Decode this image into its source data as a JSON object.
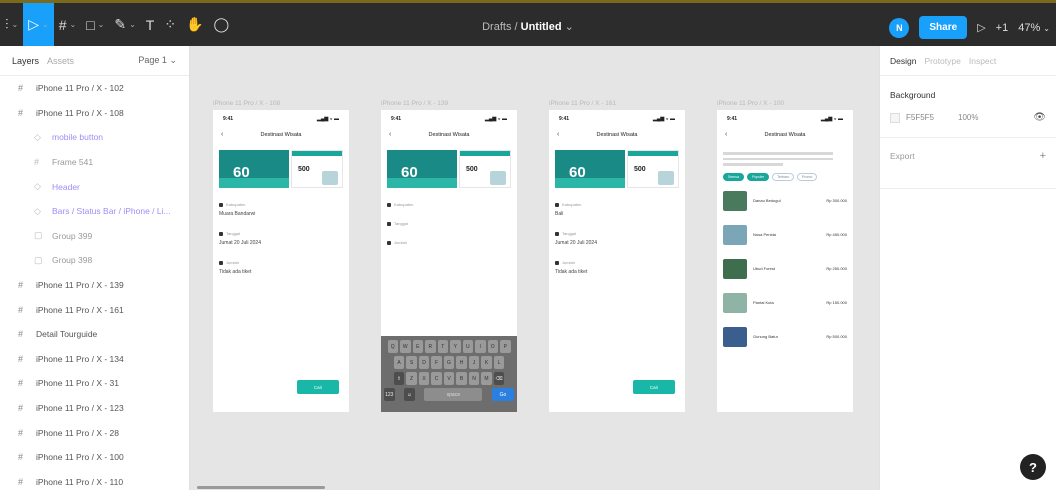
{
  "toolbar": {
    "tools": [
      {
        "name": "main-menu-icon",
        "glyph": "⫶",
        "caret": "⌄"
      },
      {
        "name": "move-tool-icon",
        "glyph": "▷",
        "caret": "⌄",
        "active": true
      },
      {
        "name": "frame-tool-icon",
        "glyph": "#",
        "caret": "⌄"
      },
      {
        "name": "shape-tool-icon",
        "glyph": "□",
        "caret": "⌄"
      },
      {
        "name": "pen-tool-icon",
        "glyph": "✎",
        "caret": "⌄"
      },
      {
        "name": "text-tool-icon",
        "glyph": "T",
        "caret": ""
      },
      {
        "name": "resources-icon",
        "glyph": "⁘",
        "caret": ""
      },
      {
        "name": "hand-tool-icon",
        "glyph": "✋",
        "caret": ""
      },
      {
        "name": "comment-tool-icon",
        "glyph": "◯",
        "caret": ""
      }
    ],
    "breadcrumb_folder": "Drafts",
    "separator": "/",
    "file_name": "Untitled",
    "file_caret": "⌄",
    "avatar_initial": "N",
    "share_label": "Share",
    "present_glyph": "▷",
    "library_label": "+1",
    "zoom": "47%",
    "zoom_caret": "⌄",
    "accent": "#18a0fb"
  },
  "left_panel": {
    "tab_layers": "Layers",
    "tab_assets": "Assets",
    "page": "Page 1",
    "page_caret": "⌄",
    "layers": [
      {
        "label": "iPhone 11 Pro / X - 102",
        "icon": "#",
        "type": "frame"
      },
      {
        "label": "iPhone 11 Pro / X - 108",
        "icon": "#",
        "type": "frame"
      },
      {
        "label": "mobile button",
        "icon": "◇",
        "type": "child comp"
      },
      {
        "label": "Frame 541",
        "icon": "#",
        "type": "child"
      },
      {
        "label": "Header",
        "icon": "◇",
        "type": "child comp"
      },
      {
        "label": "Bars / Status Bar / iPhone / Li...",
        "icon": "◇",
        "type": "child comp"
      },
      {
        "label": "Group 399",
        "icon": "▢",
        "type": "child"
      },
      {
        "label": "Group 398",
        "icon": "▢",
        "type": "child"
      },
      {
        "label": "iPhone 11 Pro / X - 139",
        "icon": "#",
        "type": "frame"
      },
      {
        "label": "iPhone 11 Pro / X - 161",
        "icon": "#",
        "type": "frame"
      },
      {
        "label": "Detail Tourguide",
        "icon": "#",
        "type": "frame"
      },
      {
        "label": "iPhone 11 Pro / X - 134",
        "icon": "#",
        "type": "frame"
      },
      {
        "label": "iPhone 11 Pro / X - 31",
        "icon": "#",
        "type": "frame"
      },
      {
        "label": "iPhone 11 Pro / X - 123",
        "icon": "#",
        "type": "frame"
      },
      {
        "label": "iPhone 11 Pro / X - 28",
        "icon": "#",
        "type": "frame"
      },
      {
        "label": "iPhone 11 Pro / X - 100",
        "icon": "#",
        "type": "frame"
      },
      {
        "label": "iPhone 11 Pro / X - 110",
        "icon": "#",
        "type": "frame"
      }
    ]
  },
  "canvas": {
    "frames": [
      {
        "label": "iPhone 11 Pro / X - 108",
        "variant": "form"
      },
      {
        "label": "iPhone 11 Pro / X - 139",
        "variant": "keyboard"
      },
      {
        "label": "iPhone 11 Pro / X - 161",
        "variant": "form"
      },
      {
        "label": "iPhone 11 Pro / X - 100",
        "variant": "list"
      }
    ],
    "time": "9:41",
    "signal": "▂▄▆ ◒ ▬",
    "back": "‹",
    "header_title": "Destinasi Wisata",
    "promo_number": "60",
    "promo_price": "500",
    "field_labels": [
      "Kabupaten",
      "Tanggal",
      "Jumlah"
    ],
    "field_values_a": [
      "Muara Bandarwi",
      "Jumat 20 Juli 2024",
      "Tidak ada tiket"
    ],
    "field_values_c": [
      "Bali",
      "Jumat 20 Juli 2024",
      "Tidak ada tiket"
    ],
    "cta_label": "Cari",
    "keyboard_rows": [
      [
        "Q",
        "W",
        "E",
        "R",
        "T",
        "Y",
        "U",
        "I",
        "O",
        "P"
      ],
      [
        "A",
        "S",
        "D",
        "F",
        "G",
        "H",
        "J",
        "K",
        "L"
      ],
      [
        "⇧",
        "Z",
        "X",
        "C",
        "V",
        "B",
        "N",
        "M",
        "⌫"
      ]
    ],
    "keyboard_bottom": [
      "123",
      "☺",
      "space",
      "Go"
    ],
    "chips": [
      "Semua",
      "Populer",
      "Terbaru",
      "Promo"
    ],
    "tours": [
      {
        "name": "Danau Bedugul",
        "price": "Rp 300.000"
      },
      {
        "name": "Nusa Penida",
        "price": "Rp 450.000"
      },
      {
        "name": "Ubud Forest",
        "price": "Rp 250.000"
      },
      {
        "name": "Pantai Kuta",
        "price": "Rp 150.000"
      },
      {
        "name": "Gunung Batur",
        "price": "Rp 500.000"
      }
    ],
    "teal": "#19b7a8"
  },
  "right_panel": {
    "tab_design": "Design",
    "tab_prototype": "Prototype",
    "tab_inspect": "Inspect",
    "background_title": "Background",
    "bg_hex": "F5F5F5",
    "bg_opacity": "100%",
    "eye_glyph": "👁",
    "export_label": "Export",
    "plus": "+"
  },
  "help_label": "?"
}
